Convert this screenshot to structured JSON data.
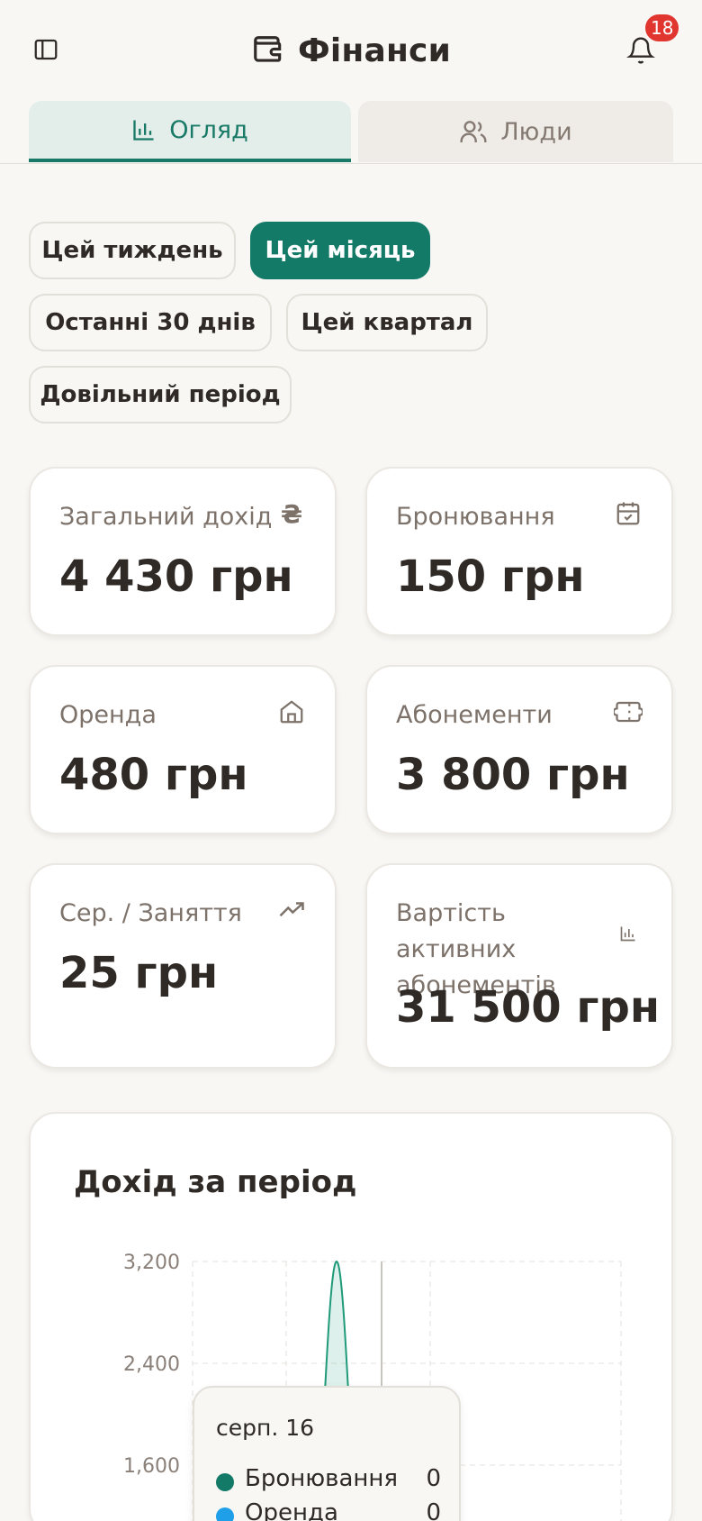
{
  "header": {
    "title": "Фінанси",
    "notifications_count": "18"
  },
  "tabs": [
    {
      "label": "Огляд",
      "active": true
    },
    {
      "label": "Люди",
      "active": false
    }
  ],
  "filters": [
    {
      "label": "Цей тиждень",
      "active": false
    },
    {
      "label": "Цей місяць",
      "active": true
    },
    {
      "label": "Останні 30 днів",
      "active": false
    },
    {
      "label": "Цей квартал",
      "active": false
    },
    {
      "label": "Довільний період",
      "active": false
    }
  ],
  "stats": [
    {
      "label": "Загальний дохід",
      "value": "4 430 грн",
      "icon": "hryvnia-icon"
    },
    {
      "label": "Бронювання",
      "value": "150 грн",
      "icon": "calendar-check-icon"
    },
    {
      "label": "Оренда",
      "value": "480 грн",
      "icon": "home-icon"
    },
    {
      "label": "Абонементи",
      "value": "3 800 грн",
      "icon": "ticket-icon"
    },
    {
      "label": "Сер. / Заняття",
      "value": "25 грн",
      "icon": "trending-up-icon"
    },
    {
      "label": "Вартість активних абонементів",
      "value": "31 500 грн",
      "icon": "bar-chart-icon"
    }
  ],
  "chart_data": {
    "type": "area",
    "title": "Дохід за період",
    "y_ticks": [
      "3,200",
      "2,400",
      "1,600"
    ],
    "ylim": [
      0,
      3200
    ],
    "series": [
      {
        "name": "Бронювання",
        "color": "#1f9a79"
      },
      {
        "name": "Оренда",
        "color": "#1e9fe8"
      }
    ],
    "peak_value": 3200
  },
  "tooltip": {
    "date": "серп. 16",
    "rows": [
      {
        "name": "Бронювання",
        "value": "0",
        "color": "#147a68"
      },
      {
        "name": "Оренда",
        "value": "0",
        "color": "#1e9fe8"
      }
    ]
  },
  "colors": {
    "accent": "#147a68",
    "badge": "#e0362f",
    "background": "#f8f7f4"
  }
}
